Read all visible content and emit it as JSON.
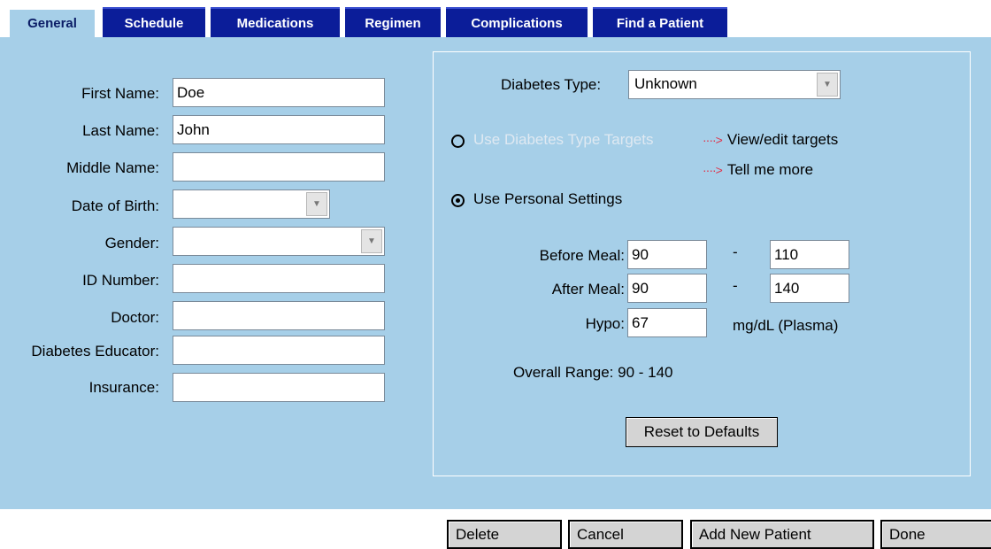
{
  "tabs": [
    {
      "label": "General"
    },
    {
      "label": "Schedule"
    },
    {
      "label": "Medications"
    },
    {
      "label": "Regimen"
    },
    {
      "label": "Complications"
    },
    {
      "label": "Find a Patient"
    }
  ],
  "patient": {
    "first_name_label": "First Name:",
    "first_name": "Doe",
    "last_name_label": "Last Name:",
    "last_name": "John",
    "middle_name_label": "Middle Name:",
    "middle_name": "",
    "dob_label": "Date of Birth:",
    "dob": "",
    "gender_label": "Gender:",
    "gender": "",
    "id_label": "ID Number:",
    "id": "",
    "doctor_label": "Doctor:",
    "doctor": "",
    "educator_label": "Diabetes Educator:",
    "educator": "",
    "insurance_label": "Insurance:",
    "insurance": ""
  },
  "targets": {
    "diabetes_type_label": "Diabetes Type:",
    "diabetes_type": "Unknown",
    "use_type_targets_label": "Use Diabetes Type Targets",
    "use_type_targets_selected": false,
    "view_edit_label": "View/edit targets",
    "tell_more_label": "Tell me more",
    "link_arrow": "····>",
    "use_personal_label": "Use Personal Settings",
    "use_personal_selected": true,
    "before_meal_label": "Before Meal:",
    "before_meal_low": "90",
    "before_meal_high": "110",
    "after_meal_label": "After Meal:",
    "after_meal_low": "90",
    "after_meal_high": "140",
    "dash": "-",
    "hypo_label": "Hypo:",
    "hypo": "67",
    "units": "mg/dL (Plasma)",
    "overall_range_label": "Overall Range: 90 - 140",
    "reset_label": "Reset to Defaults"
  },
  "actions": {
    "delete": "Delete",
    "cancel": "Cancel",
    "add_new": "Add New Patient",
    "done": "Done"
  },
  "colors": {
    "tab_bg": "#0b1d99",
    "panel_bg": "#a6cfe8",
    "link_arrow": "#e0334a",
    "disabled_text": "#dfe9f2"
  }
}
